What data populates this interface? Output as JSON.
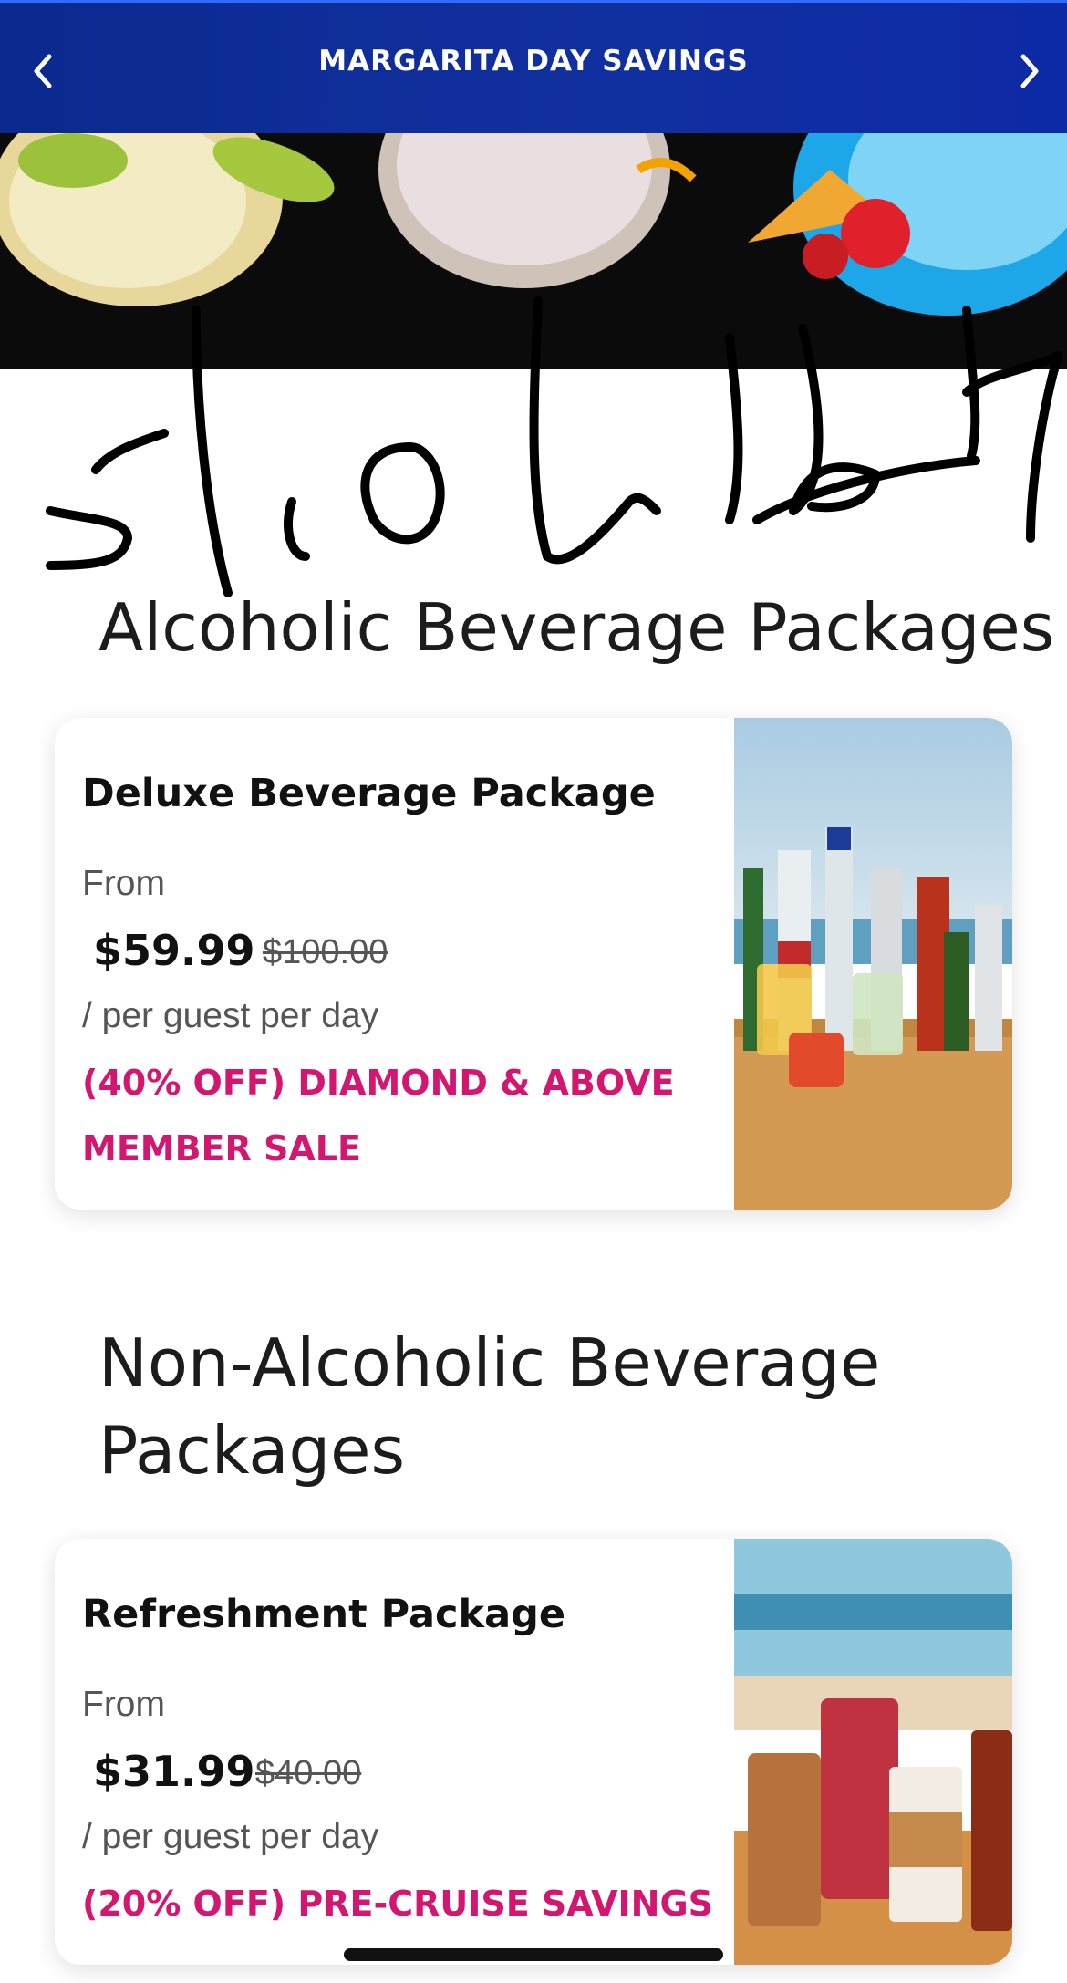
{
  "header": {
    "title": "MARGARITA DAY SAVINGS"
  },
  "handwriting": "",
  "sections": [
    {
      "title": "Alcoholic Beverage Packages",
      "card": {
        "name": "Deluxe Beverage Package",
        "from_label": "From",
        "price": "$59.99",
        "original_price": "$100.00",
        "per": "/ per guest per day",
        "promo": "(40% OFF) DIAMOND & ABOVE MEMBER SALE"
      }
    },
    {
      "title": "Non-Alcoholic Beverage Packages",
      "card": {
        "name": "Refreshment Package",
        "from_label": "From",
        "price": "$31.99",
        "original_price": "$40.00",
        "per": "/ per guest per day",
        "promo": "(20% OFF) PRE-CRUISE SAVINGS"
      }
    }
  ],
  "colors": {
    "header_bg": "#11309f",
    "promo": "#d3166f"
  },
  "icons": {
    "back": "chevron-left-icon",
    "forward": "chevron-right-icon"
  }
}
